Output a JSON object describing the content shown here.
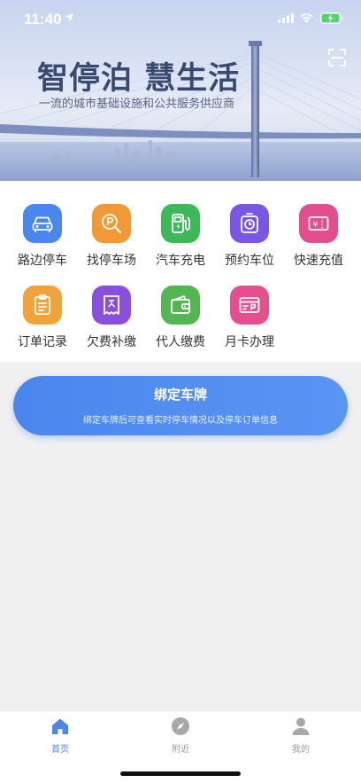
{
  "status": {
    "time": "11:40"
  },
  "banner": {
    "title": "智停泊 慧生活",
    "subtitle": "一流的城市基础设施和公共服务供应商"
  },
  "services": [
    {
      "label": "路边停车",
      "icon": "car-icon",
      "color": "#4a86ee"
    },
    {
      "label": "找停车场",
      "icon": "parking-search-icon",
      "color": "#f19a35"
    },
    {
      "label": "汽车充电",
      "icon": "charging-station-icon",
      "color": "#3fb85a"
    },
    {
      "label": "预约车位",
      "icon": "reservation-timer-icon",
      "color": "#7a55e6"
    },
    {
      "label": "快速充值",
      "icon": "recharge-ticket-icon",
      "color": "#e34f8e"
    },
    {
      "label": "订单记录",
      "icon": "order-clipboard-icon",
      "color": "#f0a33a"
    },
    {
      "label": "欠费补缴",
      "icon": "arrears-receipt-icon",
      "color": "#8a4fdc"
    },
    {
      "label": "代人缴费",
      "icon": "wallet-icon",
      "color": "#54b653"
    },
    {
      "label": "月卡办理",
      "icon": "monthly-card-icon",
      "color": "#e4508e"
    }
  ],
  "bind_card": {
    "title": "绑定车牌",
    "subtitle": "绑定车牌后可查看实时停车情况以及停车订单信息"
  },
  "tabs": [
    {
      "label": "首页",
      "icon": "home-icon",
      "active": true
    },
    {
      "label": "附近",
      "icon": "compass-icon",
      "active": false
    },
    {
      "label": "我的",
      "icon": "profile-icon",
      "active": false
    }
  ],
  "colors": {
    "accent": "#4a86ee",
    "tab_inactive": "#9a9a9a"
  }
}
